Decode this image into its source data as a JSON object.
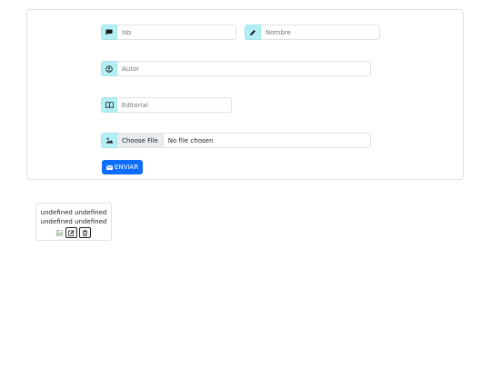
{
  "form": {
    "isb_placeholder": "Isb",
    "nombre_placeholder": "Nombre",
    "autor_placeholder": "Autor",
    "editorial_placeholder": "Editorial",
    "file_button_label": "Choose File",
    "file_status": "No file chosen",
    "submit_label": "ENVIAR"
  },
  "book_card": {
    "line1": "undefined undefined",
    "line2": "undefined undefined"
  },
  "icons": {
    "isb": "chat-icon",
    "nombre": "pencil-icon",
    "autor": "person-circle-icon",
    "editorial": "book-icon",
    "file": "image-icon",
    "submit": "envelope-icon",
    "edit": "edit-icon",
    "delete": "trash-icon"
  },
  "colors": {
    "primary": "#0d6efd",
    "icon_bg": "#b3f0f5",
    "border": "#dee2e6"
  }
}
